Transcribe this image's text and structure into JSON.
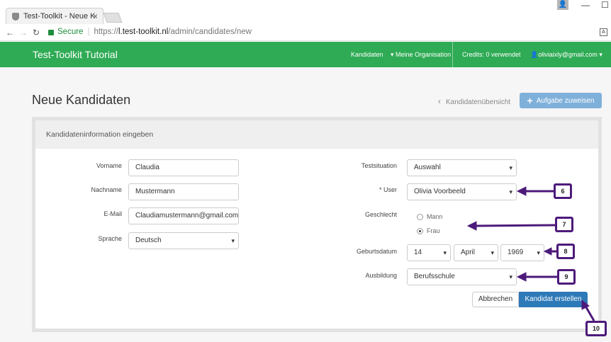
{
  "browser": {
    "tab_title": "Test-Toolkit - Neue Kandi",
    "tab_close": "×",
    "secure_label": "Secure",
    "url_scheme": "https://",
    "url_host": "l.test-toolkit.nl",
    "url_path": "/admin/candidates/new",
    "user_icon": "👤",
    "window_controls": [
      "—",
      "☐"
    ]
  },
  "navbar": {
    "brand": "Test-Toolkit Tutorial",
    "items": [
      "Kandidaten",
      "Meine Organisation"
    ],
    "credits": "Credits: 0 verwendet",
    "user_email": "oliviaixly@gmail.com"
  },
  "page": {
    "title": "Neue Kandidaten",
    "back_link": "Kandidatenübersicht",
    "assign_button": "Aufgabe zuweisen"
  },
  "panel": {
    "heading": "Kandidateninformation eingeben"
  },
  "form": {
    "vorname_label": "Vorname",
    "vorname_value": "Claudia",
    "nachname_label": "Nachname",
    "nachname_value": "Mustermann",
    "email_label": "E-Mail",
    "email_value": "Claudiamustermann@gmail.com",
    "sprache_label": "Sprache",
    "sprache_value": "Deutsch",
    "testsituation_label": "Testsituation",
    "testsituation_value": "Auswahl",
    "user_label": "* User",
    "user_value": "Olivia Voorbeeld",
    "geschlecht_label": "Geschlecht",
    "gender_options": [
      "Mann",
      "Frau"
    ],
    "gender_selected": "Frau",
    "geburtsdatum_label": "Geburtsdatum",
    "birth_day": "14",
    "birth_month": "April",
    "birth_year": "1969",
    "ausbildung_label": "Ausbildung",
    "ausbildung_value": "Berufsschule",
    "cancel_button": "Abbrechen",
    "create_button": "Kandidat erstellen"
  },
  "callouts": [
    "6",
    "7",
    "8",
    "9",
    "10"
  ],
  "colors": {
    "navbar_green": "#2fab55",
    "primary_blue": "#2e79b8",
    "assign_blue": "#7fb0da",
    "callout_purple": "#4d1a7a"
  }
}
